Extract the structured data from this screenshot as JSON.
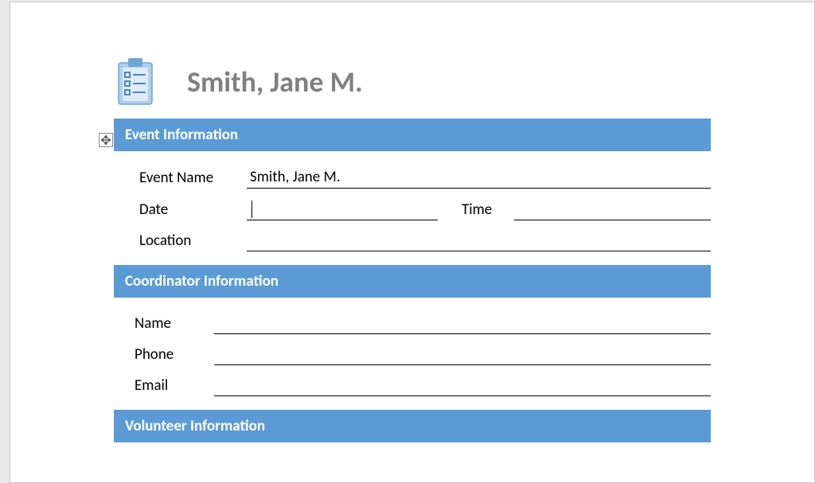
{
  "header": {
    "title": "Smith, Jane M.",
    "icon": "clipboard-icon"
  },
  "sections": {
    "event": {
      "heading": "Event Information",
      "fields": {
        "event_name": {
          "label": "Event Name",
          "value": "Smith, Jane M."
        },
        "date": {
          "label": "Date",
          "value": ""
        },
        "time": {
          "label": "Time",
          "value": ""
        },
        "location": {
          "label": "Location",
          "value": ""
        }
      }
    },
    "coordinator": {
      "heading": "Coordinator Information",
      "fields": {
        "name": {
          "label": "Name",
          "value": ""
        },
        "phone": {
          "label": "Phone",
          "value": ""
        },
        "email": {
          "label": "Email",
          "value": ""
        }
      }
    },
    "volunteer": {
      "heading": "Volunteer Information"
    }
  },
  "colors": {
    "section_bg": "#5b9bd5",
    "title_gray": "#808080"
  }
}
